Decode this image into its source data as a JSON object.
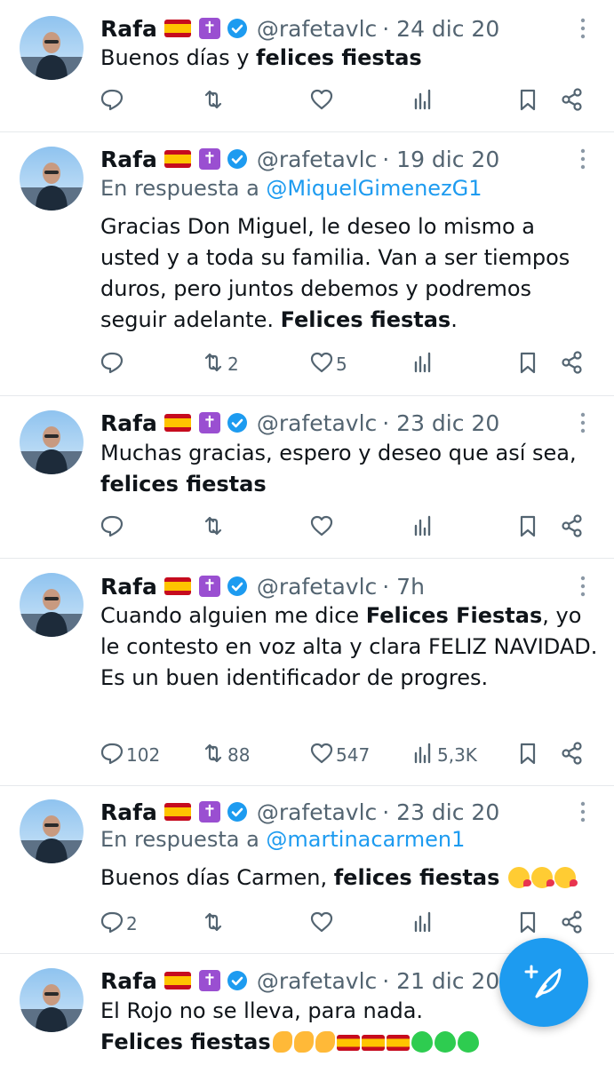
{
  "tweets": [
    {
      "name": "Rafa",
      "handle": "@rafetavlc",
      "time": "· 24 dic 20",
      "reply_prefix": "",
      "reply_to": "",
      "text_html": "Buenos días y <b>felices fiestas</b>",
      "counts": {
        "replies": "",
        "retweets": "",
        "likes": "",
        "views": ""
      }
    },
    {
      "name": "Rafa",
      "handle": "@rafetavlc",
      "time": "· 19 dic 20",
      "reply_prefix": "En respuesta a",
      "reply_to": "@MiquelGimenezG1",
      "text_html": "Gracias Don Miguel, le deseo lo mismo a usted y a toda su familia. Van a ser tiempos duros, pero juntos debemos y podremos seguir adelante. <b>Felices fiestas</b>.",
      "counts": {
        "replies": "",
        "retweets": "2",
        "likes": "5",
        "views": ""
      }
    },
    {
      "name": "Rafa",
      "handle": "@rafetavlc",
      "time": "· 23 dic 20",
      "reply_prefix": "",
      "reply_to": "",
      "text_html": "Muchas gracias, espero y deseo que así sea, <br><b>felices fiestas</b>",
      "counts": {
        "replies": "",
        "retweets": "",
        "likes": "",
        "views": ""
      }
    },
    {
      "name": "Rafa",
      "handle": "@rafetavlc",
      "time": "· 7h",
      "reply_prefix": "",
      "reply_to": "",
      "text_html": "Cuando alguien me dice <b>Felices Fiestas</b>, yo le contesto en voz alta y clara FELIZ NAVIDAD.<br>Es un buen identificador de progres.",
      "counts": {
        "replies": "102",
        "retweets": "88",
        "likes": "547",
        "views": "5,3K"
      }
    },
    {
      "name": "Rafa",
      "handle": "@rafetavlc",
      "time": "· 23 dic 20",
      "reply_prefix": "En respuesta a",
      "reply_to": "@martinacarmen1",
      "text_html": "Buenos días Carmen, <b>felices fiestas</b> <span class=\"emo kiss\"></span><span class=\"emo kiss\"></span><span class=\"emo kiss\"></span>",
      "counts": {
        "replies": "2",
        "retweets": "",
        "likes": "",
        "views": ""
      }
    },
    {
      "name": "Rafa",
      "handle": "@rafetavlc",
      "time": "· 21 dic 20",
      "reply_prefix": "",
      "reply_to": "",
      "text_html": "El Rojo no se lleva, para nada.<br><b>Felices fiestas</b><span class=\"emo arm\"></span><span class=\"emo arm\"></span><span class=\"emo arm\"></span><span class=\"emo flagE\"></span><span class=\"emo flagE\"></span><span class=\"emo flagE\"></span><span class=\"emo heart\"></span><span class=\"emo heart\"></span><span class=\"emo heart\"></span>",
      "counts": {
        "replies": "",
        "retweets": "",
        "likes": "",
        "views": ""
      }
    }
  ],
  "colors": {
    "accent": "#1d9bf0",
    "muted": "#536471",
    "text": "#0f1419",
    "divider": "#e6e9ec"
  },
  "icons": [
    "reply-icon",
    "retweet-icon",
    "like-icon",
    "views-icon",
    "bookmark-icon",
    "share-icon",
    "more-icon",
    "verified-icon",
    "compose-icon"
  ]
}
